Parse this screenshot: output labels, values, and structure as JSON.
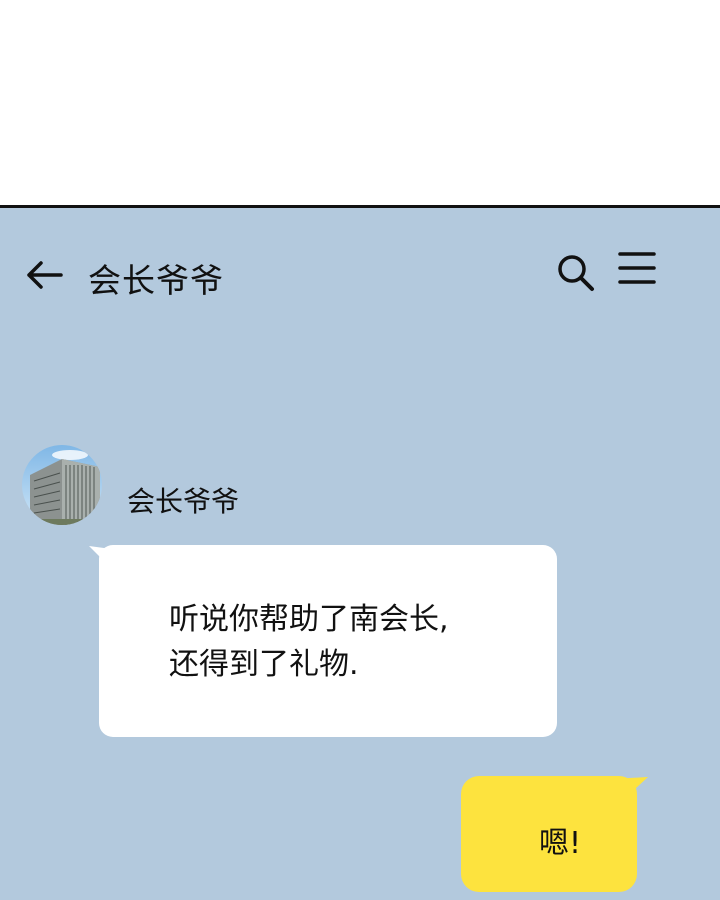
{
  "header": {
    "title": "会长爷爷",
    "back_icon": "back-arrow-icon",
    "search_icon": "search-icon",
    "menu_icon": "hamburger-menu-icon"
  },
  "messages": [
    {
      "sender": "会长爷爷",
      "avatar": "building-avatar",
      "direction": "incoming",
      "lines": [
        "听说你帮助了南会长,",
        "还得到了礼物."
      ]
    },
    {
      "direction": "outgoing",
      "text": "嗯!"
    }
  ],
  "colors": {
    "chat_background": "#b3c9dd",
    "incoming_bubble": "#ffffff",
    "outgoing_bubble": "#fde33e"
  }
}
